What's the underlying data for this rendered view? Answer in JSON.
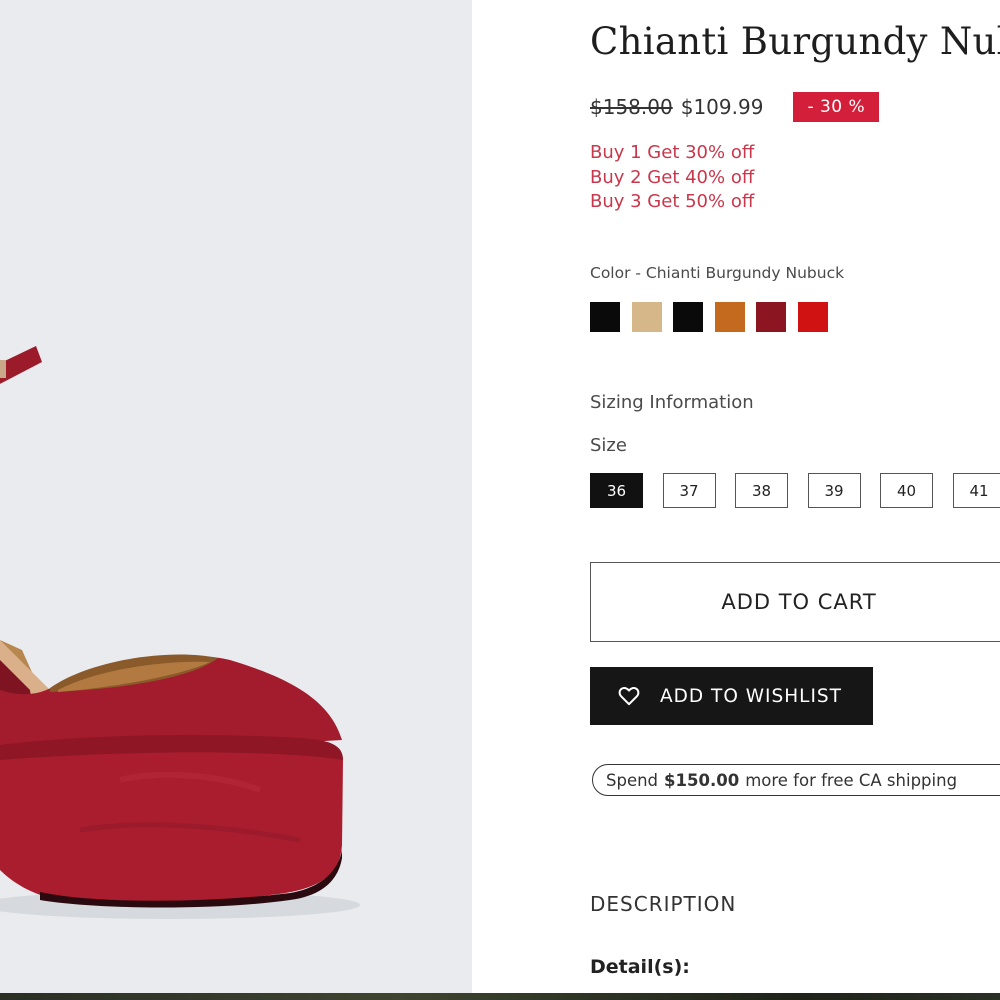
{
  "product": {
    "title": "Chianti Burgundy Nubuck",
    "price_original": "$158.00",
    "price_sale": "$109.99",
    "discount_badge": "- 30 %",
    "promotions": [
      "Buy 1 Get 30% off",
      "Buy 2 Get 40% off",
      "Buy 3 Get 50% off"
    ]
  },
  "color": {
    "label": "Color - Chianti Burgundy Nubuck",
    "swatches": [
      "#0a0a0a",
      "#d6b789",
      "#0a0a0a",
      "#c46a1f",
      "#8c1522",
      "#d11212"
    ],
    "selected_index": 4
  },
  "sizing": {
    "info_label": "Sizing Information",
    "size_label": "Size",
    "sizes": [
      "36",
      "37",
      "38",
      "39",
      "40",
      "41"
    ],
    "selected": "36"
  },
  "actions": {
    "add_to_cart": "ADD TO CART",
    "add_to_wishlist": "ADD TO WISHLIST"
  },
  "shipping": {
    "prefix": "Spend",
    "amount": "$150.00",
    "suffix": "more for free CA shipping"
  },
  "sections": {
    "description": "DESCRIPTION",
    "details": "Detail(s):"
  },
  "icons": {
    "wishlist": "heart-outline-icon"
  },
  "theme": {
    "accent_red": "#d31f3a",
    "promo_red": "#c8374b",
    "dark_button": "#161616",
    "image_background": "#e9ebee"
  }
}
